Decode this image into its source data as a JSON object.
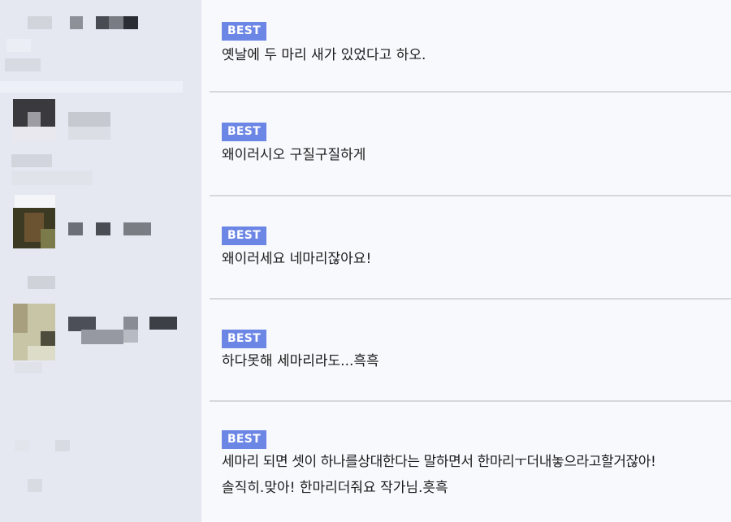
{
  "comments": [
    {
      "badge": "BEST",
      "text": "옛날에 두 마리 새가 있었다고 하오."
    },
    {
      "badge": "BEST",
      "text": "왜이러시오 구질구질하게"
    },
    {
      "badge": "BEST",
      "text": "왜이러세요 네마리잖아요!"
    },
    {
      "badge": "BEST",
      "text": "하다못해 세마리라도...흑흑"
    },
    {
      "badge": "BEST",
      "text_line1": "세마리 되면 셋이 하나를상대한다는 말하면서 한마리ㅜ더내놓으라고할거잖아!",
      "text_line2": "솔직히.맞아! 한마리더줘요 작가님.흣흑"
    }
  ],
  "colors": {
    "badge_bg": "#6c86e6",
    "left_panel_bg": "#e6e8f1",
    "content_bg": "#f8f9fc"
  }
}
